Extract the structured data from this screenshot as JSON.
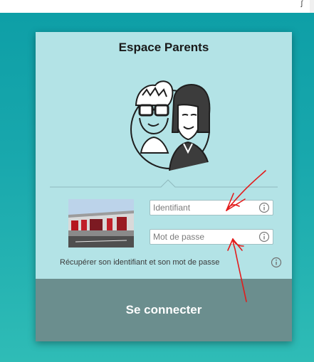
{
  "page": {
    "top_glyph": "ʃ"
  },
  "card": {
    "title": "Espace Parents",
    "identifier_placeholder": "Identifiant",
    "password_placeholder": "Mot de passe",
    "recover_link": "Récupérer son identifiant et son mot de passe",
    "connect_button": "Se connecter"
  },
  "icons": {
    "avatar": "parents-avatar-icon",
    "info": "info-circle-icon"
  },
  "colors": {
    "background": "#1aa7ac",
    "card": "#b3e3e6",
    "button": "#6b8e8e",
    "annotation": "#e31b1b"
  }
}
